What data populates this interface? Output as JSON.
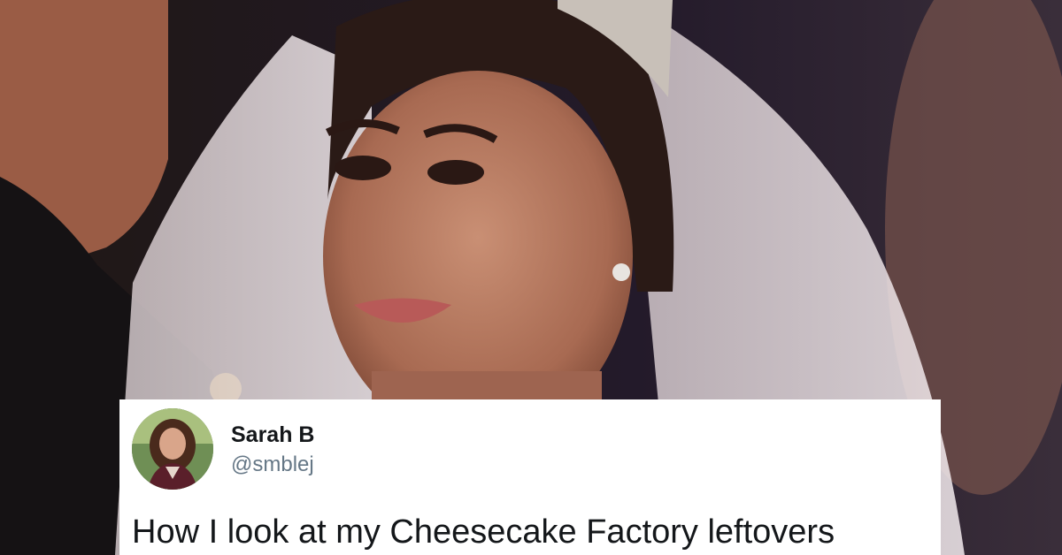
{
  "tweet": {
    "display_name": "Sarah B",
    "handle": "@smblej",
    "text": "How I look at my Cheesecake Factory leftovers",
    "avatar_icon": "user-avatar-photo"
  },
  "colors": {
    "card_background": "#ffffff",
    "name_color": "#14171a",
    "handle_color": "#657786",
    "text_color": "#14171a"
  }
}
